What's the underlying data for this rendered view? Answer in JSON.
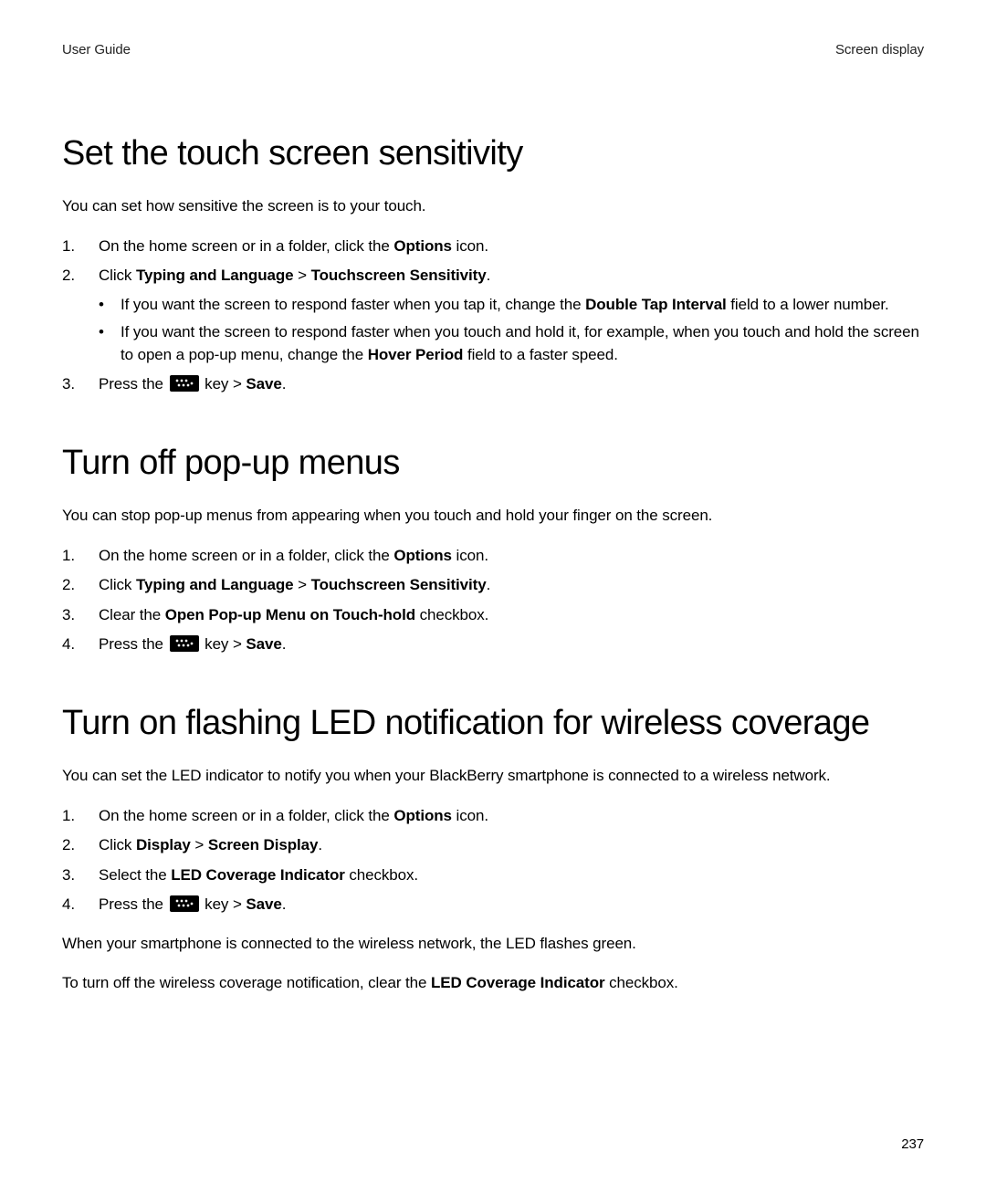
{
  "header": {
    "left": "User Guide",
    "right": "Screen display"
  },
  "pageNumber": "237",
  "sections": [
    {
      "title": "Set the touch screen sensitivity",
      "intro": "You can set how sensitive the screen is to your touch.",
      "steps": [
        {
          "pre": "On the home screen or in a folder, click the ",
          "bold": "Options",
          "post": " icon."
        },
        {
          "pre": "Click ",
          "bold": "Typing and Language",
          "mid": " > ",
          "bold2": "Touchscreen Sensitivity",
          "post": ".",
          "bullets": [
            {
              "pre": "If you want the screen to respond faster when you tap it, change the ",
              "bold": "Double Tap Interval",
              "post": " field to a lower number."
            },
            {
              "pre": "If you want the screen to respond faster when you touch and hold it, for example, when you touch and hold the screen to open a pop-up menu, change the ",
              "bold": "Hover Period",
              "post": " field to a faster speed."
            }
          ]
        },
        {
          "pressKey": true,
          "pre": "Press the ",
          "mid": " key > ",
          "bold": "Save",
          "post": "."
        }
      ]
    },
    {
      "title": "Turn off pop-up menus",
      "intro": "You can stop pop-up menus from appearing when you touch and hold your finger on the screen.",
      "steps": [
        {
          "pre": "On the home screen or in a folder, click the ",
          "bold": "Options",
          "post": " icon."
        },
        {
          "pre": "Click ",
          "bold": "Typing and Language",
          "mid": " > ",
          "bold2": "Touchscreen Sensitivity",
          "post": "."
        },
        {
          "pre": "Clear the ",
          "bold": "Open Pop-up Menu on Touch-hold",
          "post": " checkbox."
        },
        {
          "pressKey": true,
          "pre": "Press the ",
          "mid": " key > ",
          "bold": "Save",
          "post": "."
        }
      ]
    },
    {
      "title": "Turn on flashing LED notification for wireless coverage",
      "intro": "You can set the LED indicator to notify you when your BlackBerry smartphone is connected to a wireless network.",
      "steps": [
        {
          "pre": "On the home screen or in a folder, click the ",
          "bold": "Options",
          "post": " icon."
        },
        {
          "pre": "Click ",
          "bold": "Display",
          "mid": " > ",
          "bold2": "Screen Display",
          "post": "."
        },
        {
          "pre": "Select the ",
          "bold": "LED Coverage Indicator",
          "post": " checkbox."
        },
        {
          "pressKey": true,
          "pre": "Press the ",
          "mid": " key > ",
          "bold": "Save",
          "post": "."
        }
      ],
      "after": [
        {
          "pre": "When your smartphone is connected to the wireless network, the LED flashes green."
        },
        {
          "pre": "To turn off the wireless coverage notification, clear the ",
          "bold": "LED Coverage Indicator",
          "post": " checkbox."
        }
      ]
    }
  ]
}
